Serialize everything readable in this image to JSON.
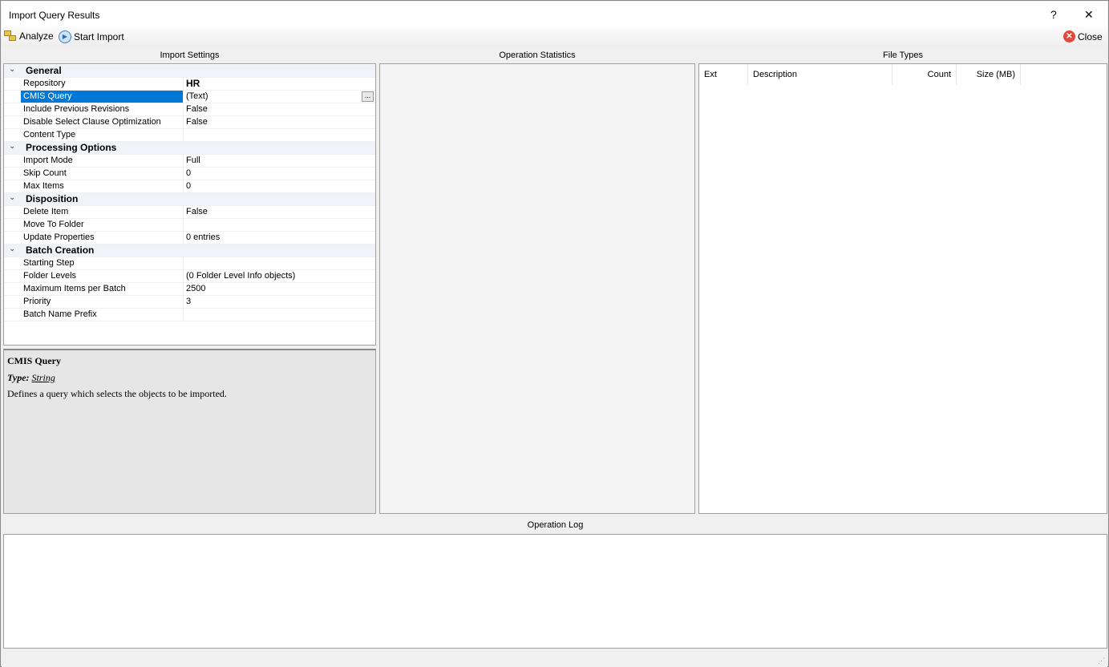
{
  "window": {
    "title": "Import Query Results",
    "help": "?",
    "close": "✕"
  },
  "toolbar": {
    "analyze": "Analyze",
    "start_import": "Start Import",
    "close": "Close"
  },
  "panels": {
    "import_settings": "Import Settings",
    "operation_statistics": "Operation Statistics",
    "file_types": "File Types",
    "operation_log": "Operation Log"
  },
  "properties": [
    {
      "cat": "General"
    },
    {
      "name": "Repository",
      "value": "HR",
      "bold": true
    },
    {
      "name": "CMIS Query",
      "value": "(Text)",
      "selected": true,
      "ellipsis": "..."
    },
    {
      "name": "Include Previous Revisions",
      "value": "False"
    },
    {
      "name": "Disable Select Clause Optimization",
      "value": "False"
    },
    {
      "name": "Content Type",
      "value": ""
    },
    {
      "cat": "Processing Options"
    },
    {
      "name": "Import Mode",
      "value": "Full"
    },
    {
      "name": "Skip Count",
      "value": "0"
    },
    {
      "name": "Max Items",
      "value": "0"
    },
    {
      "cat": "Disposition"
    },
    {
      "name": "Delete Item",
      "value": "False"
    },
    {
      "name": "Move To Folder",
      "value": ""
    },
    {
      "name": "Update Properties",
      "value": "0 entries"
    },
    {
      "cat": "Batch Creation"
    },
    {
      "name": "Starting Step",
      "value": ""
    },
    {
      "name": "Folder Levels",
      "value": "(0 Folder Level Info objects)"
    },
    {
      "name": "Maximum Items per Batch",
      "value": "2500"
    },
    {
      "name": "Priority",
      "value": "3"
    },
    {
      "name": "Batch Name Prefix",
      "value": ""
    }
  ],
  "description": {
    "title": "CMIS Query",
    "type_label": "Type:",
    "type_value": "String",
    "text": "Defines a query which selects the objects to be imported."
  },
  "file_types": {
    "columns": [
      "Ext",
      "Description",
      "Count",
      "Size (MB)"
    ]
  }
}
